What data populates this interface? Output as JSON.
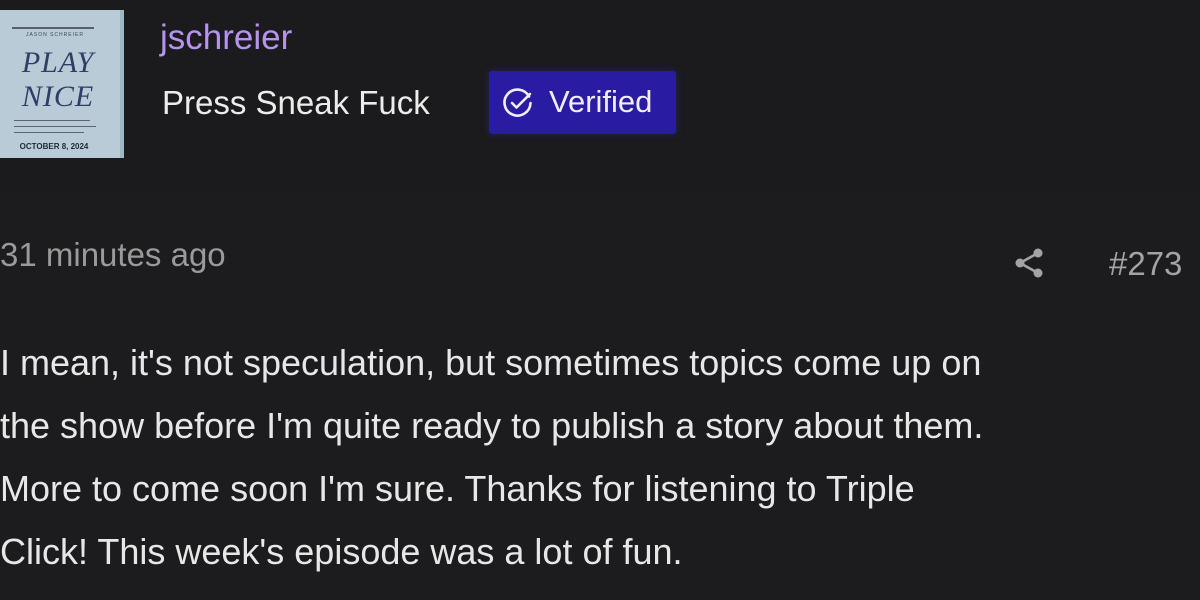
{
  "avatar": {
    "author": "JASON SCHREIER",
    "title_line1": "PLAY",
    "title_line2": "NICE",
    "date": "OCTOBER 8, 2024"
  },
  "user": {
    "username": "jschreier",
    "title": "Press Sneak Fuck",
    "badge_icon": "check-circle-icon",
    "badge_label": "Verified",
    "badge_color": "#2a1ba3",
    "username_color": "#b693f1"
  },
  "post": {
    "timestamp": "31 minutes ago",
    "share_icon": "share-icon",
    "number": "#273",
    "message_lines": [
      "I mean, it's not speculation, but sometimes topics come up on",
      "the show before I'm quite ready to publish a story about them.",
      "More to come soon I'm sure. Thanks for listening to Triple",
      "Click! This week's episode was a lot of fun."
    ]
  }
}
